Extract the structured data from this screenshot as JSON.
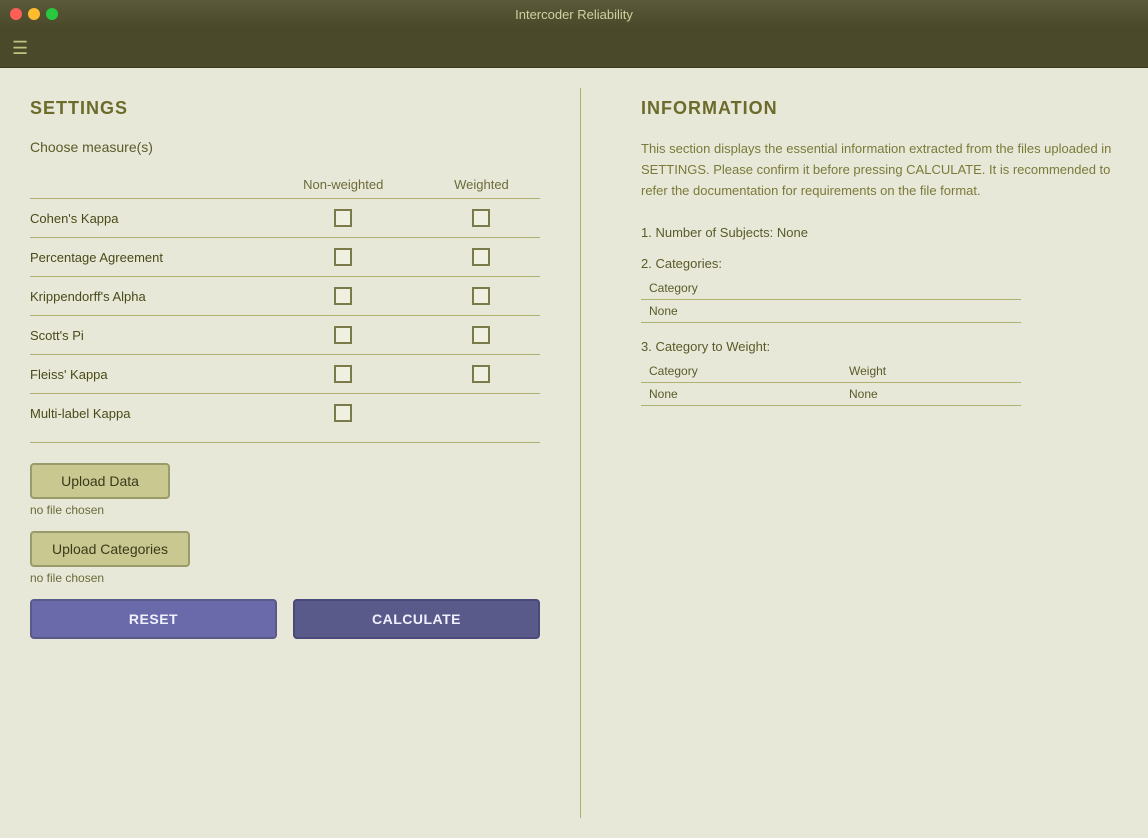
{
  "window": {
    "title": "Intercoder Reliability"
  },
  "menubar": {
    "hamburger_symbol": "☰"
  },
  "settings": {
    "section_title": "SETTINGS",
    "choose_measures_label": "Choose measure(s)",
    "columns": {
      "measure": "",
      "non_weighted": "Non-weighted",
      "weighted": "Weighted"
    },
    "measures": [
      {
        "label": "Cohen's Kappa",
        "non_weighted": false,
        "weighted": false
      },
      {
        "label": "Percentage Agreement",
        "non_weighted": false,
        "weighted": false
      },
      {
        "label": "Krippendorff's Alpha",
        "non_weighted": false,
        "weighted": false
      },
      {
        "label": "Scott's Pi",
        "non_weighted": false,
        "weighted": false
      },
      {
        "label": "Fleiss' Kappa",
        "non_weighted": false,
        "weighted": false
      },
      {
        "label": "Multi-label Kappa",
        "non_weighted": false,
        "weighted": null
      }
    ],
    "upload_data_label": "Upload Data",
    "no_file_chosen_1": "no file chosen",
    "upload_categories_label": "Upload Categories",
    "no_file_chosen_2": "no file chosen",
    "reset_label": "RESET",
    "calculate_label": "CALCULATE"
  },
  "information": {
    "section_title": "INFORMATION",
    "description": "This section displays the essential information extracted from the files uploaded in SETTINGS. Please confirm it before pressing CALCULATE. It is recommended to refer the documentation for requirements on the file format.",
    "items": [
      {
        "number": "1.",
        "label": "Number of Subjects:",
        "value": "None"
      }
    ],
    "categories_title": "2. Categories:",
    "categories_table": {
      "header": "Category",
      "rows": [
        "None"
      ]
    },
    "category_weight_title": "3. Category to Weight:",
    "category_weight_table": {
      "headers": [
        "Category",
        "Weight"
      ],
      "rows": [
        {
          "category": "None",
          "weight": "None"
        }
      ]
    }
  },
  "traffic_lights": {
    "close": "close",
    "minimize": "minimize",
    "maximize": "maximize"
  }
}
